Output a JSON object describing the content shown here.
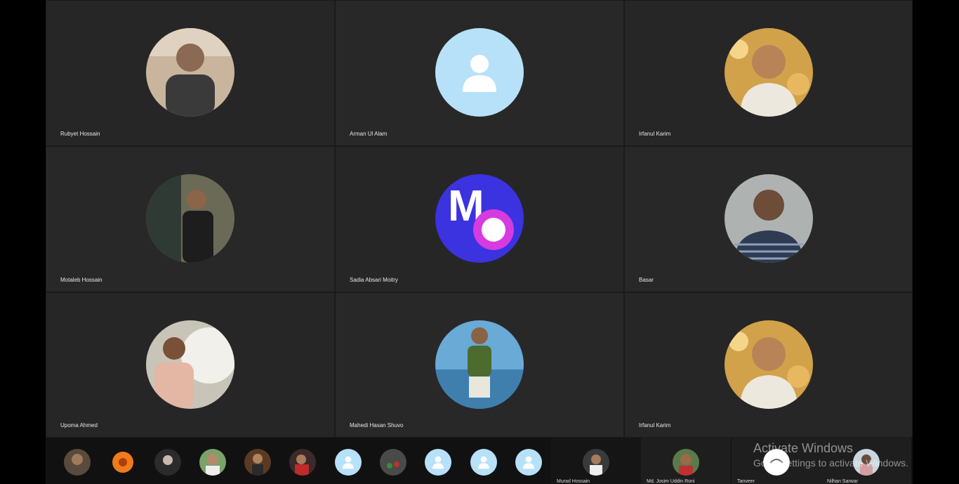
{
  "participants": [
    {
      "name": "Rubyet Hossain"
    },
    {
      "name": "Arman Ul Alam"
    },
    {
      "name": "Irfanul Karim"
    },
    {
      "name": "Motaleb Hossain"
    },
    {
      "name": "Sadia Absari Moitry"
    },
    {
      "name": "Basar"
    },
    {
      "name": "Upoma Ahmed"
    },
    {
      "name": "Mahedi Hasan Shuvo"
    },
    {
      "name": "Irfanul Karim"
    }
  ],
  "strip": {
    "named": [
      {
        "name": "Murad Hossain"
      },
      {
        "name": "Md. Josim Uddin Roni"
      },
      {
        "name": "Tanveer"
      },
      {
        "name": "Nilhan Sarwar"
      }
    ]
  },
  "watermark": {
    "title": "Activate Windows",
    "subtitle": "Go to Settings to activate Windows."
  },
  "colors": {
    "tile_bg": "#262626",
    "placeholder_avatar": "#b7e1f8",
    "logo_blue": "#3b32e0",
    "logo_pink": "#d63be0"
  }
}
